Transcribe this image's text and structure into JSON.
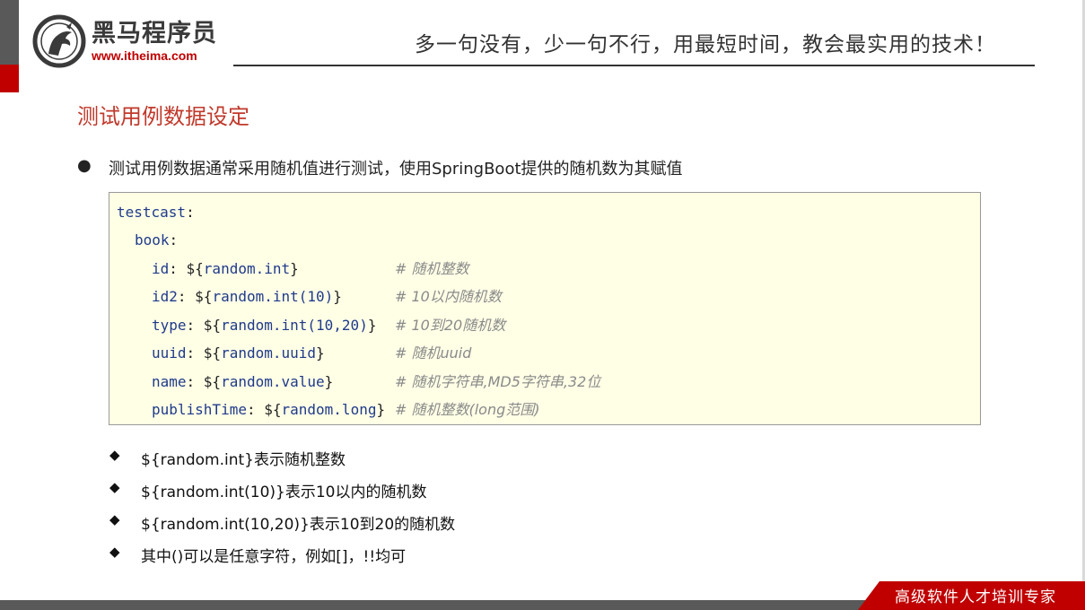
{
  "header": {
    "logo_name": "黑马程序员",
    "logo_url": "www.itheima.com",
    "slogan": "多一句没有，少一句不行，用最短时间，教会最实用的技术！"
  },
  "title": "测试用例数据设定",
  "intro": "测试用例数据通常采用随机值进行测试，使用SpringBoot提供的随机数为其赋值",
  "code": [
    {
      "key": "testcast",
      "value": "",
      "comment": ""
    },
    {
      "key": "book",
      "value": "",
      "comment": ""
    },
    {
      "key": "id",
      "value": "random.int",
      "comment": "# 随机整数"
    },
    {
      "key": "id2",
      "value": "random.int(10)",
      "comment": "# 10以内随机数"
    },
    {
      "key": "type",
      "value": "random.int(10,20)",
      "comment": "# 10到20随机数"
    },
    {
      "key": "uuid",
      "value": "random.uuid",
      "comment": "# 随机uuid"
    },
    {
      "key": "name",
      "value": "random.value",
      "comment": "# 随机字符串,MD5字符串,32位"
    },
    {
      "key": "publishTime",
      "value": "random.long",
      "comment": "# 随机整数(long范围)"
    }
  ],
  "notes": [
    "${random.int}表示随机整数",
    "${random.int(10)}表示10以内的随机数",
    "${random.int(10,20)}表示10到20的随机数",
    "其中()可以是任意字符，例如[]，!!均可"
  ],
  "footer": {
    "tagline": "高级软件人才培训专家"
  },
  "colors": {
    "brand_red": "#c00000",
    "title_red": "#c0392b",
    "code_bg": "#ffffe6",
    "code_key": "#1f3a8a"
  }
}
